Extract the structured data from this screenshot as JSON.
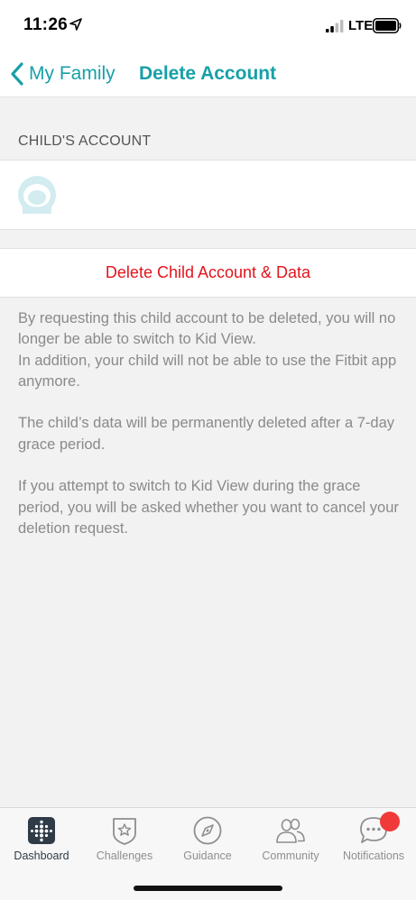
{
  "status_bar": {
    "time": "11:26",
    "network": "LTE"
  },
  "nav": {
    "back_label": "My Family",
    "title": "Delete Account"
  },
  "section": {
    "header": "CHILD'S ACCOUNT"
  },
  "actions": {
    "delete_label": "Delete Child Account & Data"
  },
  "info": {
    "paragraph_1_line_1": "By requesting this child account to be deleted, you will no longer be able to switch to Kid View.",
    "paragraph_1_line_2": "In addition, your child will not be able to use the Fitbit app anymore.",
    "paragraph_2": "The child’s data will be permanently deleted after a 7-day grace period.",
    "paragraph_3": "If you attempt to switch to Kid View during the grace period, you will be asked whether you want to cancel your deletion request."
  },
  "tabs": [
    {
      "label": "Dashboard",
      "icon": "dashboard-icon",
      "active": true
    },
    {
      "label": "Challenges",
      "icon": "challenges-icon",
      "active": false
    },
    {
      "label": "Guidance",
      "icon": "guidance-icon",
      "active": false
    },
    {
      "label": "Community",
      "icon": "community-icon",
      "active": false
    },
    {
      "label": "Notifications",
      "icon": "notifications-icon",
      "active": false
    }
  ],
  "colors": {
    "accent": "#17a0a8",
    "destructive": "#e3141b",
    "badge": "#f03a3a"
  }
}
